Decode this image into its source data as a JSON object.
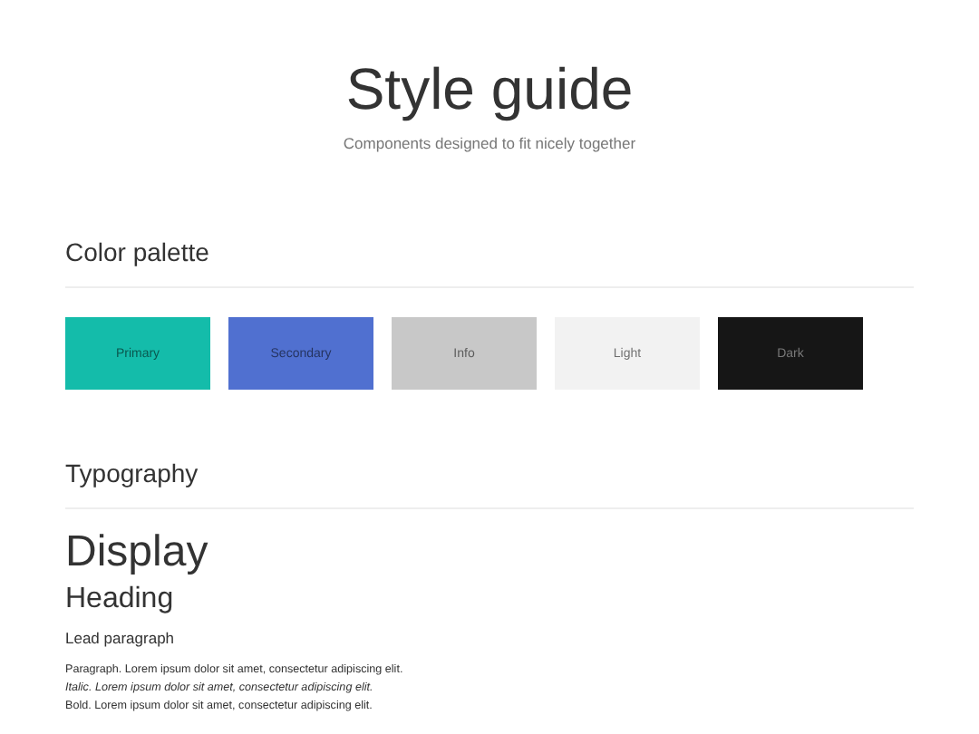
{
  "header": {
    "title": "Style guide",
    "subtitle": "Components designed to fit nicely together"
  },
  "color_palette": {
    "heading": "Color palette",
    "swatches": [
      {
        "label": "Primary",
        "color": "#14bcaa"
      },
      {
        "label": "Secondary",
        "color": "#5070d0"
      },
      {
        "label": "Info",
        "color": "#c8c8c8"
      },
      {
        "label": "Light",
        "color": "#f2f2f2"
      },
      {
        "label": "Dark",
        "color": "#161616"
      }
    ]
  },
  "typography": {
    "heading": "Typography",
    "samples": [
      {
        "kind": "display",
        "text": "Display"
      },
      {
        "kind": "heading",
        "text": "Heading"
      },
      {
        "kind": "lead",
        "text": "Lead paragraph"
      },
      {
        "kind": "paragraph",
        "text": "Paragraph. Lorem ipsum dolor sit amet, consectetur adipiscing elit."
      },
      {
        "kind": "italic",
        "text": "Italic. Lorem ipsum dolor sit amet, consectetur adipiscing elit."
      },
      {
        "kind": "paragraph",
        "text": "Bold. Lorem ipsum dolor sit amet, consectetur adipiscing elit."
      }
    ]
  }
}
